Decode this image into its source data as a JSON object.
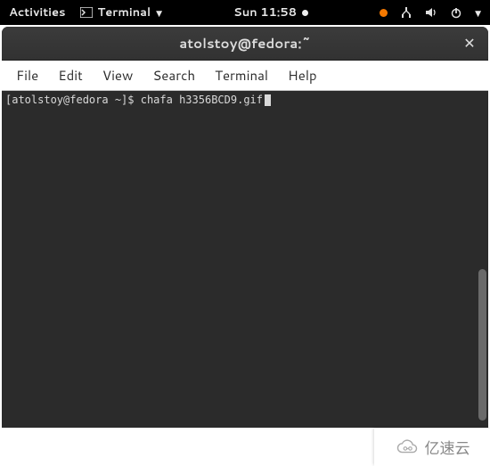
{
  "topbar": {
    "activities": "Activities",
    "app_name": "Terminal",
    "clock": "Sun 11:58"
  },
  "window_title": "atolstoy@fedora:~",
  "menubar": {
    "file": "File",
    "edit": "Edit",
    "view": "View",
    "search": "Search",
    "terminal": "Terminal",
    "help": "Help"
  },
  "terminal": {
    "prompt": "[atolstoy@fedora ~]$ ",
    "command": "chafa h3356BCD9.gif"
  },
  "watermark": "亿速云"
}
